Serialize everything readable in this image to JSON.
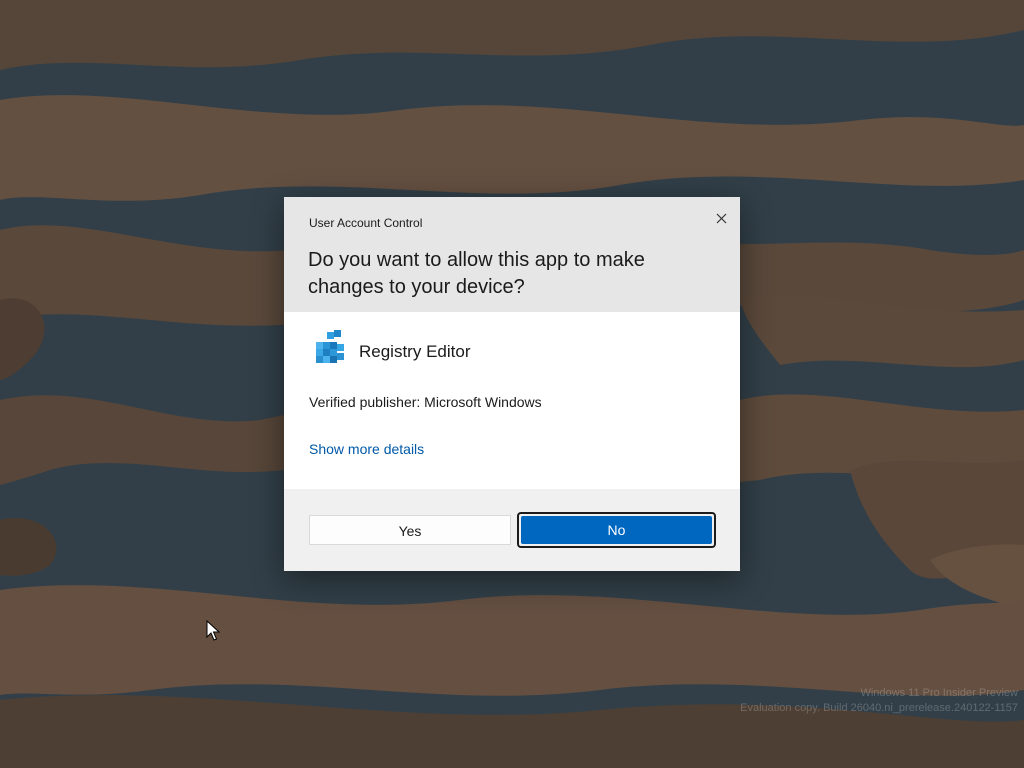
{
  "dialog": {
    "title": "User Account Control",
    "question": "Do you want to allow this app to make changes to your device?",
    "app_name": "Registry Editor",
    "app_icon": "registry-editor-icon",
    "publisher": "Verified publisher: Microsoft Windows",
    "details_link": "Show more details",
    "yes_label": "Yes",
    "no_label": "No",
    "close_icon": "close-icon",
    "accent_color": "#0067c0"
  },
  "watermark": {
    "line1": "Windows 11 Pro Insider Preview",
    "line2": "Evaluation copy. Build 26040.ni_prerelease.240122-1157"
  }
}
